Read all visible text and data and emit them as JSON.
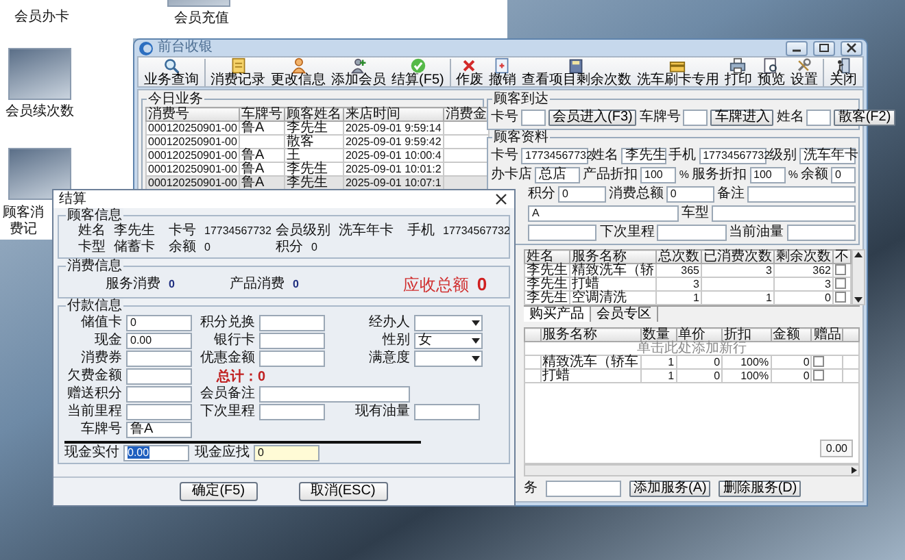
{
  "desktop_icons": [
    {
      "label": "会员办卡",
      "kind": "label_only"
    },
    {
      "label": "会员充值",
      "kind": "photo"
    },
    {
      "label": "会员续次数",
      "kind": "photo"
    },
    {
      "label": "顾客消费记",
      "kind": "photo"
    }
  ],
  "main_window": {
    "title": "前台收银",
    "toolbar": [
      {
        "kind": "search",
        "label": "业务查询"
      },
      {
        "kind": "separator"
      },
      {
        "kind": "notepad",
        "label": "消费记录"
      },
      {
        "kind": "person",
        "label": "更改信息"
      },
      {
        "kind": "person_add",
        "label": "添加会员"
      },
      {
        "kind": "check",
        "label": "结算(F5)"
      },
      {
        "kind": "separator"
      },
      {
        "kind": "cross",
        "label": "作废"
      },
      {
        "kind": "document",
        "label": "撤销"
      },
      {
        "kind": "book",
        "label": "查看项目剩余次数"
      },
      {
        "kind": "card",
        "label": "洗车刷卡专用"
      },
      {
        "kind": "printer",
        "label": "打印"
      },
      {
        "kind": "preview",
        "label": "预览"
      },
      {
        "kind": "tools",
        "label": "设置"
      },
      {
        "kind": "separator"
      },
      {
        "kind": "exit",
        "label": "关闭"
      }
    ],
    "today_business": {
      "title": "今日业务",
      "columns": [
        "消费号",
        "车牌号",
        "顾客姓名",
        "来店时间",
        "消费金"
      ],
      "rows": [
        {
          "number": "000120250901-00",
          "plate": "鲁A",
          "name": "李先生",
          "time": "2025-09-01 9:59:14",
          "selected": false
        },
        {
          "number": "000120250901-00",
          "name": "散客",
          "time": "2025-09-01 9:59:42",
          "selected": false
        },
        {
          "number": "000120250901-00",
          "plate": "鲁A",
          "name": "王",
          "time": "2025-09-01 10:00:4",
          "selected": false
        },
        {
          "number": "000120250901-00",
          "plate": "鲁A",
          "name": "李先生",
          "time": "2025-09-01 10:01:2",
          "selected": false
        },
        {
          "number": "000120250901-00",
          "plate": "鲁A",
          "name": "李先生",
          "time": "2025-09-01 10:07:1",
          "selected": true
        }
      ]
    },
    "customer_arrival": {
      "title": "顾客到达",
      "items": [
        {
          "kind": "label",
          "text": "卡号"
        },
        {
          "kind": "field"
        },
        {
          "kind": "button",
          "text": "会员进入(F3)"
        },
        {
          "kind": "label",
          "text": "车牌号"
        },
        {
          "kind": "field"
        },
        {
          "kind": "button",
          "text": "车牌进入"
        },
        {
          "kind": "label",
          "text": "姓名"
        },
        {
          "kind": "field"
        },
        {
          "kind": "button",
          "text": "散客(F2)"
        }
      ]
    },
    "customer_info": {
      "title": "顾客资料",
      "rows": [
        [
          {
            "kind": "field",
            "label": "卡号",
            "value": "17734567732"
          },
          {
            "kind": "field",
            "label": "姓名",
            "value": "李先生"
          },
          {
            "kind": "field",
            "label": "手机",
            "value": "17734567732"
          },
          {
            "kind": "field",
            "label": "级别",
            "value": "洗车年卡"
          }
        ],
        [
          {
            "kind": "field",
            "label": "办卡店",
            "value": "总店"
          },
          {
            "kind": "field",
            "label": "产品折扣",
            "value": "100",
            "unit": "%"
          },
          {
            "kind": "field",
            "label": "服务折扣",
            "value": "100",
            "unit": "%"
          },
          {
            "kind": "field",
            "label": "余额",
            "value": "0"
          }
        ],
        [
          {
            "kind": "field",
            "label": "积分",
            "value": "0"
          },
          {
            "kind": "field",
            "label": "消费总额",
            "value": "0"
          },
          {
            "kind": "wide_field",
            "label": "备注"
          }
        ],
        [
          {
            "kind": "field",
            "value": "A"
          },
          {
            "kind": "field",
            "label": "车型"
          }
        ],
        [
          {
            "kind": "field"
          },
          {
            "kind": "field",
            "label": "下次里程"
          },
          {
            "kind": "field",
            "label": "当前油量"
          }
        ]
      ]
    },
    "service_counts": {
      "columns": [
        "姓名",
        "服务名称",
        "总次数",
        "已消费次数",
        "剩余次数",
        "不"
      ],
      "rows": [
        {
          "name": "李先生",
          "service": "精致洗车（轿",
          "total": "365",
          "used": "3",
          "remaining": "362",
          "checked": false
        },
        {
          "name": "李先生",
          "service": "打蜡",
          "total": "3",
          "remaining": "3",
          "checked": false
        },
        {
          "name": "李先生",
          "service": "空调清洗",
          "total": "1",
          "used": "1",
          "remaining": "0",
          "checked": false
        }
      ]
    },
    "tabs": [
      {
        "label": "购买产品",
        "selected": true
      },
      {
        "label": "会员专区",
        "selected": false
      }
    ],
    "service_lines": {
      "columns": [
        "服务名称",
        "数量",
        "单价",
        "折扣",
        "金额",
        "赠品"
      ],
      "add_row_hint": "单击此处添加新行",
      "rows": [
        {
          "service": "精致洗车（轿车",
          "qty": "1",
          "price": "0",
          "discount": "100%",
          "amount": "0",
          "gift": false
        },
        {
          "service": "打蜡",
          "qty": "1",
          "price": "0",
          "discount": "100%",
          "amount": "0",
          "gift": false
        }
      ],
      "total": "0.00"
    },
    "bottom_bar": {
      "label": "务",
      "buttons": [
        "添加服务(A)",
        "删除服务(D)"
      ]
    }
  },
  "checkout_dialog": {
    "title": "结算",
    "customer": {
      "title": "顾客信息",
      "rows": [
        [
          {
            "label": "姓名",
            "value": "李先生"
          },
          {
            "label": "卡号",
            "value": "17734567732"
          },
          {
            "label": "会员级别",
            "value": "洗车年卡"
          },
          {
            "label": "手机",
            "value": "17734567732"
          }
        ],
        [
          {
            "label": "卡型",
            "value": "储蓄卡"
          },
          {
            "label": "余额",
            "value": "0"
          },
          {
            "label": "积分",
            "value": "0"
          }
        ]
      ]
    },
    "consumption": {
      "title": "消费信息",
      "items": [
        {
          "kind": "amount",
          "label": "服务消费",
          "value": "0"
        },
        {
          "kind": "amount",
          "label": "产品消费",
          "value": "0"
        },
        {
          "kind": "total",
          "label": "应收总额",
          "value": "0"
        }
      ]
    },
    "payment": {
      "title": "付款信息",
      "rows": [
        [
          {
            "kind": "field",
            "label": "储值卡",
            "value": "0"
          },
          {
            "kind": "field",
            "label": "积分兑换"
          },
          {
            "kind": "select",
            "label": "经办人"
          }
        ],
        [
          {
            "kind": "field",
            "label": "现金",
            "value": "0.00"
          },
          {
            "kind": "field",
            "label": "银行卡"
          },
          {
            "kind": "select",
            "label": "性别",
            "value": "女"
          }
        ],
        [
          {
            "kind": "field",
            "label": "消费券"
          },
          {
            "kind": "field",
            "label": "优惠金额"
          },
          {
            "kind": "select",
            "label": "满意度"
          }
        ],
        [
          {
            "kind": "field",
            "label": "欠费金额"
          },
          {
            "kind": "total",
            "text": "总计：0"
          }
        ],
        [
          {
            "kind": "field",
            "label": "赠送积分"
          },
          {
            "kind": "wide_field",
            "label": "会员备注"
          }
        ],
        [
          {
            "kind": "field",
            "label": "当前里程"
          },
          {
            "kind": "field",
            "label": "下次里程"
          },
          {
            "kind": "field",
            "label": "现有油量"
          }
        ],
        [
          {
            "kind": "field",
            "label": "车牌号",
            "value": "鲁A"
          }
        ]
      ],
      "cash": [
        {
          "kind": "input",
          "label": "现金实付",
          "value": "0.00",
          "selected": true
        },
        {
          "kind": "readonly",
          "label": "现金应找",
          "value": "0",
          "selected": false
        }
      ]
    },
    "buttons": [
      "确定(F5)",
      "取消(ESC)"
    ]
  }
}
